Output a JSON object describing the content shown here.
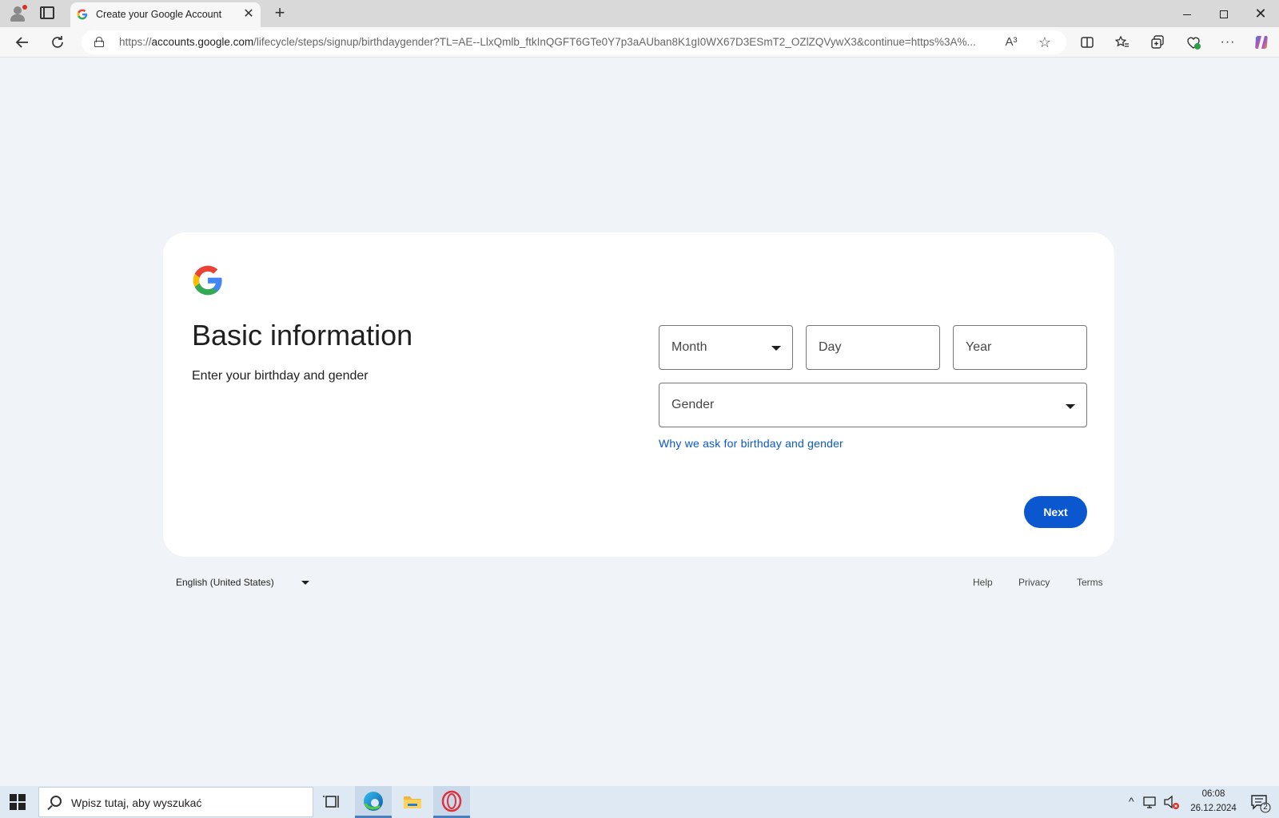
{
  "browser": {
    "tab_title": "Create your Google Account",
    "url_prefix": "https://",
    "url_host": "accounts.google.com",
    "url_rest": "/lifecycle/steps/signup/birthdaygender?TL=AE--LlxQmlb_ftkInQGFT6GTe0Y7p3aAUban8K1gI0WX67D3ESmT2_OZlZQVywX3&continue=https%3A%...",
    "read_aloud_label": "A³"
  },
  "card": {
    "heading": "Basic information",
    "subheading": "Enter your birthday and gender",
    "month_placeholder": "Month",
    "day_placeholder": "Day",
    "year_placeholder": "Year",
    "gender_placeholder": "Gender",
    "why_link": "Why we ask for birthday and gender",
    "next_label": "Next"
  },
  "footer": {
    "language": "English (United States)",
    "help": "Help",
    "privacy": "Privacy",
    "terms": "Terms"
  },
  "taskbar": {
    "search_placeholder": "Wpisz tutaj, aby wyszukać",
    "time": "06:08",
    "date": "26.12.2024",
    "notification_count": "2"
  },
  "colors": {
    "accent": "#0b57d0",
    "page_background": "#f0f4f8",
    "card_background": "#ffffff"
  }
}
